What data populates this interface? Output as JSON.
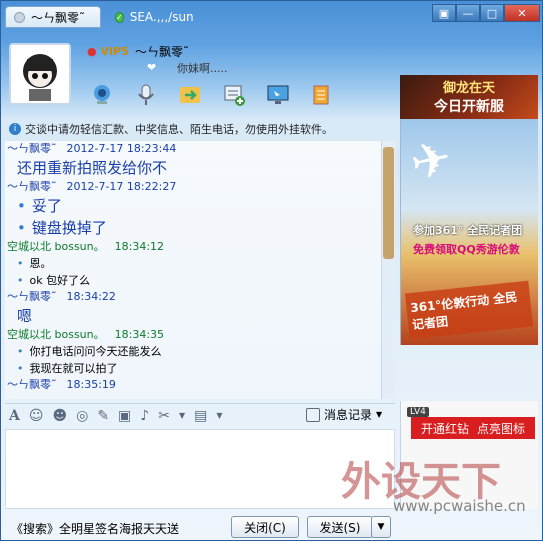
{
  "titlebar": {
    "active_tab_label": "〜ㄣ飘零˜",
    "inactive_tab_label": "SEA.,,,/sun",
    "buttons": [
      "▣",
      "—",
      "□",
      "✕"
    ]
  },
  "profile": {
    "vip_label": "VIP5",
    "nickname": "〜ㄣ飘零˜",
    "signature": "你妹啊....."
  },
  "ads": {
    "top_line1": "御龙在天",
    "top_line2": "今日开新服",
    "side_line1": "参加361° 全民记者团",
    "side_line2": "免费领取QQ秀游伦敦",
    "side_line3": "361°伦敦行动 全民记者团",
    "bottom_level": "LV4",
    "bottom_left": "开通红钻",
    "bottom_right": "点亮图标"
  },
  "notice": "交谈中请勿轻信汇款、中奖信息、陌生电话，勿使用外挂软件。",
  "messages": [
    {
      "type": "me",
      "sender": "〜ㄣ飘零˜",
      "time": "2012-7-17  18:23:44",
      "lines": [
        "还用重新拍照发给你不"
      ],
      "size": "big",
      "bullet": false
    },
    {
      "type": "me",
      "sender": "〜ㄣ飘零˜",
      "time": "2012-7-17  18:22:27",
      "lines": [
        "妥了",
        "键盘换掉了"
      ],
      "size": "big",
      "bullet": true
    },
    {
      "type": "other",
      "sender": "空城以北 bossun。",
      "time": "18:34:12",
      "lines": [
        "恩。"
      ],
      "size": "small",
      "bullet": true
    },
    {
      "type": "other2",
      "sender": "",
      "time": "",
      "lines": [
        "ok 包好了么"
      ],
      "size": "small",
      "bullet": true
    },
    {
      "type": "me",
      "sender": "〜ㄣ飘零˜",
      "time": "18:34:22",
      "lines": [
        "嗯"
      ],
      "size": "big",
      "bullet": false
    },
    {
      "type": "other",
      "sender": "空城以北 bossun。",
      "time": "18:34:35",
      "lines": [
        "你打电话问问今天还能发么",
        "我现在就可以拍了"
      ],
      "size": "small",
      "bullet": true
    },
    {
      "type": "me",
      "sender": "〜ㄣ飘零˜",
      "time": "18:35:19",
      "lines": [],
      "size": "big",
      "bullet": false
    }
  ],
  "format_toolbar": {
    "history_label": "消息记录"
  },
  "watermark": {
    "text": "外设天下",
    "url": "www.pcwaishe.cn"
  },
  "bottom": {
    "search_ad": "《搜索》全明星签名海报天天送",
    "close_label": "关闭(C)",
    "send_label": "发送(S)"
  }
}
